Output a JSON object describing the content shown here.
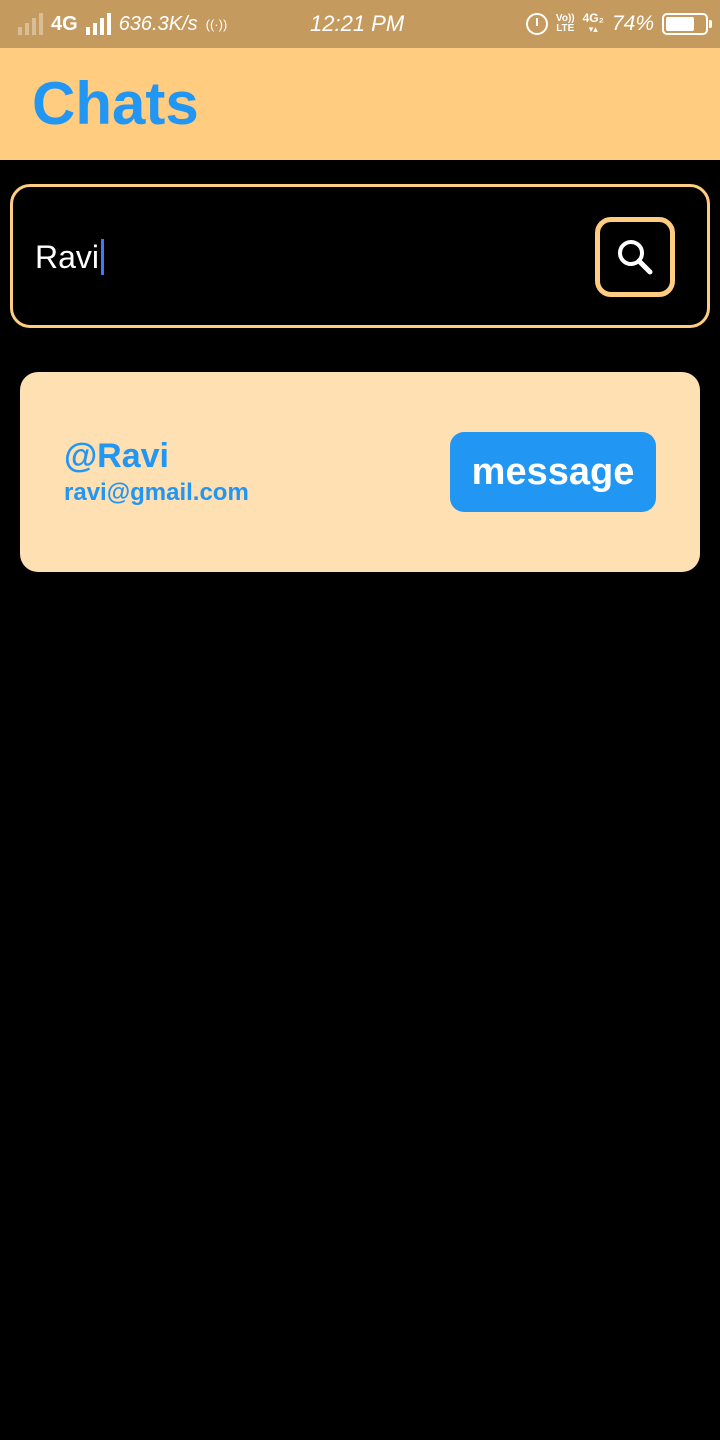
{
  "status_bar": {
    "network_type": "4G",
    "speed": "636.3K/s",
    "time": "12:21 PM",
    "volte_top": "Vo))",
    "volte_bottom": "LTE",
    "network2_top": "4G₂",
    "network2_bottom": "▾▴",
    "battery": "74%",
    "battery_level": 0.74,
    "bar_color": "#C49A5E"
  },
  "header": {
    "title": "Chats",
    "background": "#FFCC80",
    "title_color": "#2196F3"
  },
  "search": {
    "value": "Ravi",
    "button_icon": "search-icon",
    "border_color": "#FFCC80"
  },
  "results": [
    {
      "username": "@Ravi",
      "email": "ravi@gmail.com",
      "action_label": "message",
      "card_color": "#FFE0B2",
      "button_color": "#2196F3"
    }
  ]
}
